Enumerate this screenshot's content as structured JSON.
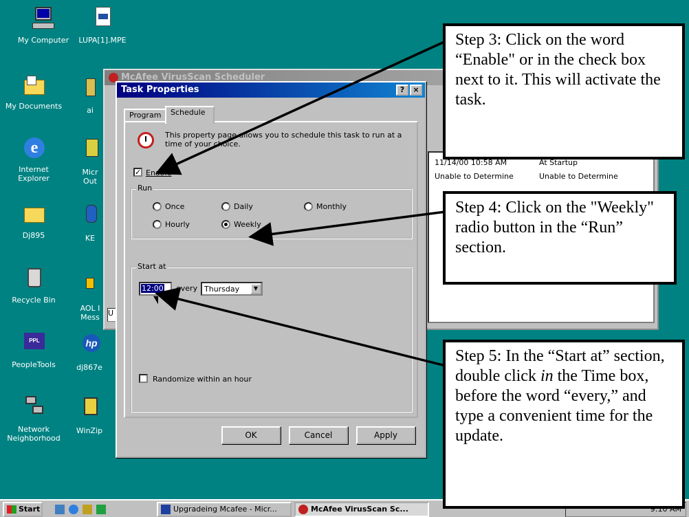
{
  "desktop": {
    "icons_col1": [
      {
        "label": "My Computer",
        "icon": "my-computer-icon"
      },
      {
        "label": "My Documents",
        "icon": "folder-documents-icon"
      },
      {
        "label": "Internet Explorer",
        "icon": "internet-explorer-icon"
      },
      {
        "label": "Dj895",
        "icon": "folder-icon"
      },
      {
        "label": "Recycle Bin",
        "icon": "recycle-bin-icon"
      },
      {
        "label": "PeopleTools",
        "icon": "peopletools-icon"
      },
      {
        "label": "Network Neighborhood",
        "icon": "network-icon"
      }
    ],
    "icons_col2": [
      {
        "label": "LUPA[1].MPE",
        "icon": "media-file-icon"
      },
      {
        "label": "ai",
        "icon": "app-icon"
      },
      {
        "label": "Micr Out",
        "icon": "outlook-icon"
      },
      {
        "label": "KE",
        "icon": "app-icon"
      },
      {
        "label": "AOL I Mess",
        "icon": "aol-messenger-icon"
      },
      {
        "label": "dj867e",
        "icon": "hp-icon"
      },
      {
        "label": "WinZip",
        "icon": "winzip-icon"
      }
    ]
  },
  "background_window": {
    "title": "McAfee VirusScan Scheduler",
    "rows": [
      [
        "11/14/00 10:58 AM",
        "At Startup"
      ],
      [
        "Unable to Determine",
        "Unable to Determine"
      ]
    ],
    "status_prefix": "U"
  },
  "dialog": {
    "title": "Task Properties",
    "help_btn": "?",
    "close_btn": "×",
    "tabs": [
      "Program",
      "Schedule"
    ],
    "active_tab": "Schedule",
    "description": "This property page allows you to schedule this task to run at a time of your choice.",
    "enable_label": "Enable",
    "enable_checked": true,
    "run_group": "Run",
    "run_options": [
      "Once",
      "Daily",
      "Monthly",
      "Hourly",
      "Weekly"
    ],
    "run_selected": "Weekly",
    "start_group": "Start at",
    "time_value": "12:00",
    "every_label": "every",
    "day_value": "Thursday",
    "randomize_label": "Randomize within an hour",
    "ok": "OK",
    "cancel": "Cancel",
    "apply": "Apply"
  },
  "taskbar": {
    "start": "Start",
    "items": [
      "Upgradeing Mcafee - Micr...",
      "McAfee VirusScan Sc..."
    ],
    "clock": "9:10 AM"
  },
  "callouts": {
    "step3": "Step 3: Click on the word “Enable\" or in the check box next to it. This will activate the task.",
    "step4": "Step 4: Click on the \"Weekly\" radio button in the “Run” section.",
    "step5_a": "Step 5: In the “Start at” section, double click ",
    "step5_em": "in",
    "step5_b": " the Time box, before the word “every,” and type a convenient time for the update."
  }
}
